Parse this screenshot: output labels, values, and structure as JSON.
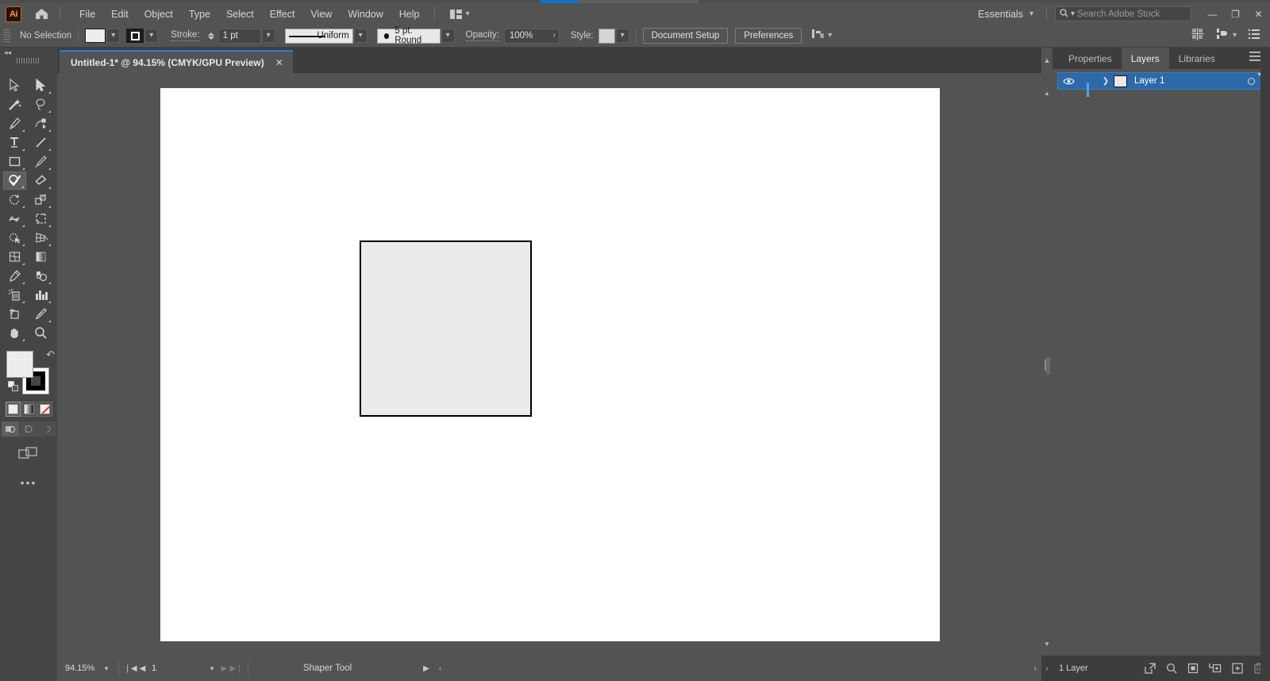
{
  "app": {
    "logo": "Ai",
    "home_icon": "home-icon"
  },
  "menubar": {
    "items": [
      "File",
      "Edit",
      "Object",
      "Type",
      "Select",
      "Effect",
      "View",
      "Window",
      "Help"
    ],
    "arrange_icon": "arrange-documents-icon",
    "workspace": "Essentials",
    "search_placeholder": "Search Adobe Stock",
    "search_value": "",
    "window_controls": {
      "minimize": "—",
      "restore": "❐",
      "close": "✕"
    }
  },
  "controlbar": {
    "selection_status": "No Selection",
    "fill_label": "fill-swatch",
    "stroke_swatch_label": "stroke-swatch",
    "stroke_label": "Stroke:",
    "stroke_weight": "1 pt",
    "stroke_profile": "Uniform",
    "brush_definition": "5 pt. Round",
    "opacity_label": "Opacity:",
    "opacity_value": "100%",
    "style_label": "Style:",
    "document_setup": "Document Setup",
    "preferences": "Preferences",
    "align_icon": "align-to-selection-icon",
    "right_icons": [
      "arrange-grid-icon",
      "align-panel-icon",
      "options-menu-icon"
    ]
  },
  "tabs": {
    "document_title": "Untitled-1* @ 94.15% (CMYK/GPU Preview)",
    "close_glyph": "✕"
  },
  "tools": {
    "rows": [
      [
        {
          "name": "selection-tool",
          "icon": "cursor-arrow",
          "active": false,
          "corner": false
        },
        {
          "name": "direct-selection-tool",
          "icon": "cursor-filled",
          "active": false,
          "corner": true
        }
      ],
      [
        {
          "name": "magic-wand-tool",
          "icon": "magic-wand",
          "active": false,
          "corner": false
        },
        {
          "name": "lasso-tool",
          "icon": "lasso",
          "active": false,
          "corner": true
        }
      ],
      [
        {
          "name": "pen-tool",
          "icon": "pen",
          "active": false,
          "corner": true
        },
        {
          "name": "curvature-tool",
          "icon": "curvature",
          "active": false,
          "corner": true
        }
      ],
      [
        {
          "name": "type-tool",
          "icon": "type-T",
          "active": false,
          "corner": true
        },
        {
          "name": "line-segment-tool",
          "icon": "line",
          "active": false,
          "corner": true
        }
      ],
      [
        {
          "name": "rectangle-tool",
          "icon": "rectangle",
          "active": false,
          "corner": true
        },
        {
          "name": "paintbrush-tool",
          "icon": "paintbrush",
          "active": false,
          "corner": true
        }
      ],
      [
        {
          "name": "shaper-tool",
          "icon": "shaper",
          "active": true,
          "corner": true
        },
        {
          "name": "eraser-tool",
          "icon": "eraser",
          "active": false,
          "corner": true
        }
      ],
      [
        {
          "name": "rotate-tool",
          "icon": "rotate",
          "active": false,
          "corner": true
        },
        {
          "name": "scale-tool",
          "icon": "scale",
          "active": false,
          "corner": true
        }
      ],
      [
        {
          "name": "width-tool",
          "icon": "warp",
          "active": false,
          "corner": true
        },
        {
          "name": "free-transform-tool",
          "icon": "free-transform",
          "active": false,
          "corner": true
        }
      ],
      [
        {
          "name": "shape-builder-tool",
          "icon": "shape-builder",
          "active": false,
          "corner": true
        },
        {
          "name": "perspective-grid-tool",
          "icon": "perspective-grid",
          "active": false,
          "corner": true
        }
      ],
      [
        {
          "name": "mesh-tool",
          "icon": "mesh",
          "active": false,
          "corner": false
        },
        {
          "name": "gradient-tool",
          "icon": "gradient",
          "active": false,
          "corner": false
        }
      ],
      [
        {
          "name": "eyedropper-tool",
          "icon": "eyedropper",
          "active": false,
          "corner": true
        },
        {
          "name": "blend-tool",
          "icon": "blend",
          "active": false,
          "corner": true
        }
      ],
      [
        {
          "name": "symbol-sprayer-tool",
          "icon": "symbol-sprayer",
          "active": false,
          "corner": true
        },
        {
          "name": "column-graph-tool",
          "icon": "bar-chart",
          "active": false,
          "corner": true
        }
      ],
      [
        {
          "name": "artboard-tool",
          "icon": "artboard",
          "active": false,
          "corner": false
        },
        {
          "name": "slice-tool",
          "icon": "knife",
          "active": false,
          "corner": true
        }
      ],
      [
        {
          "name": "hand-tool",
          "icon": "hand",
          "active": false,
          "corner": true
        },
        {
          "name": "zoom-tool",
          "icon": "magnifier",
          "active": false,
          "corner": false
        }
      ]
    ],
    "fill_color": "#ededed",
    "stroke_color": "#000000",
    "swap_icon": "swap-fill-stroke-icon",
    "default_icon": "default-fill-stroke-icon",
    "paint_modes": [
      "color-swatch",
      "gradient-swatch",
      "none-swatch"
    ],
    "draw_modes": [
      "draw-normal",
      "draw-behind",
      "draw-inside"
    ],
    "screen_mode_icon": "change-screen-mode-icon",
    "more_tools": "•••"
  },
  "canvas": {
    "artboard_background": "#ffffff",
    "shape": {
      "name": "drawn-square",
      "fill": "#ebebeb",
      "stroke": "#000000"
    }
  },
  "statusbar": {
    "zoom_value": "94.15%",
    "page_value": "1",
    "current_tool": "Shaper Tool",
    "first_glyph": "❘◀",
    "prev_glyph": "◀",
    "next_glyph": "▶",
    "last_glyph": "▶❘",
    "play_glyph": "▶",
    "left_chev": "‹",
    "right_chev": "›"
  },
  "rightpanel": {
    "tabs": [
      {
        "label": "Properties",
        "active": false
      },
      {
        "label": "Layers",
        "active": true
      },
      {
        "label": "Libraries",
        "active": false
      }
    ],
    "menu_icon": "panel-menu-icon",
    "layers": [
      {
        "name": "Layer 1",
        "visible": true,
        "locked": false,
        "color": "#ededed",
        "selected": true
      }
    ],
    "footer": {
      "count": "1 Layer",
      "icons": [
        "locate-object-icon",
        "search-icon",
        "make-clipping-mask-icon",
        "create-sublayer-icon",
        "create-new-layer-icon",
        "delete-selection-icon"
      ]
    }
  },
  "colors": {
    "chrome": "#535353",
    "panel_dark": "#3d3d3d",
    "toolbar": "#454545",
    "accent_blue": "#2d68a8",
    "progress_blue": "#1473c6"
  }
}
